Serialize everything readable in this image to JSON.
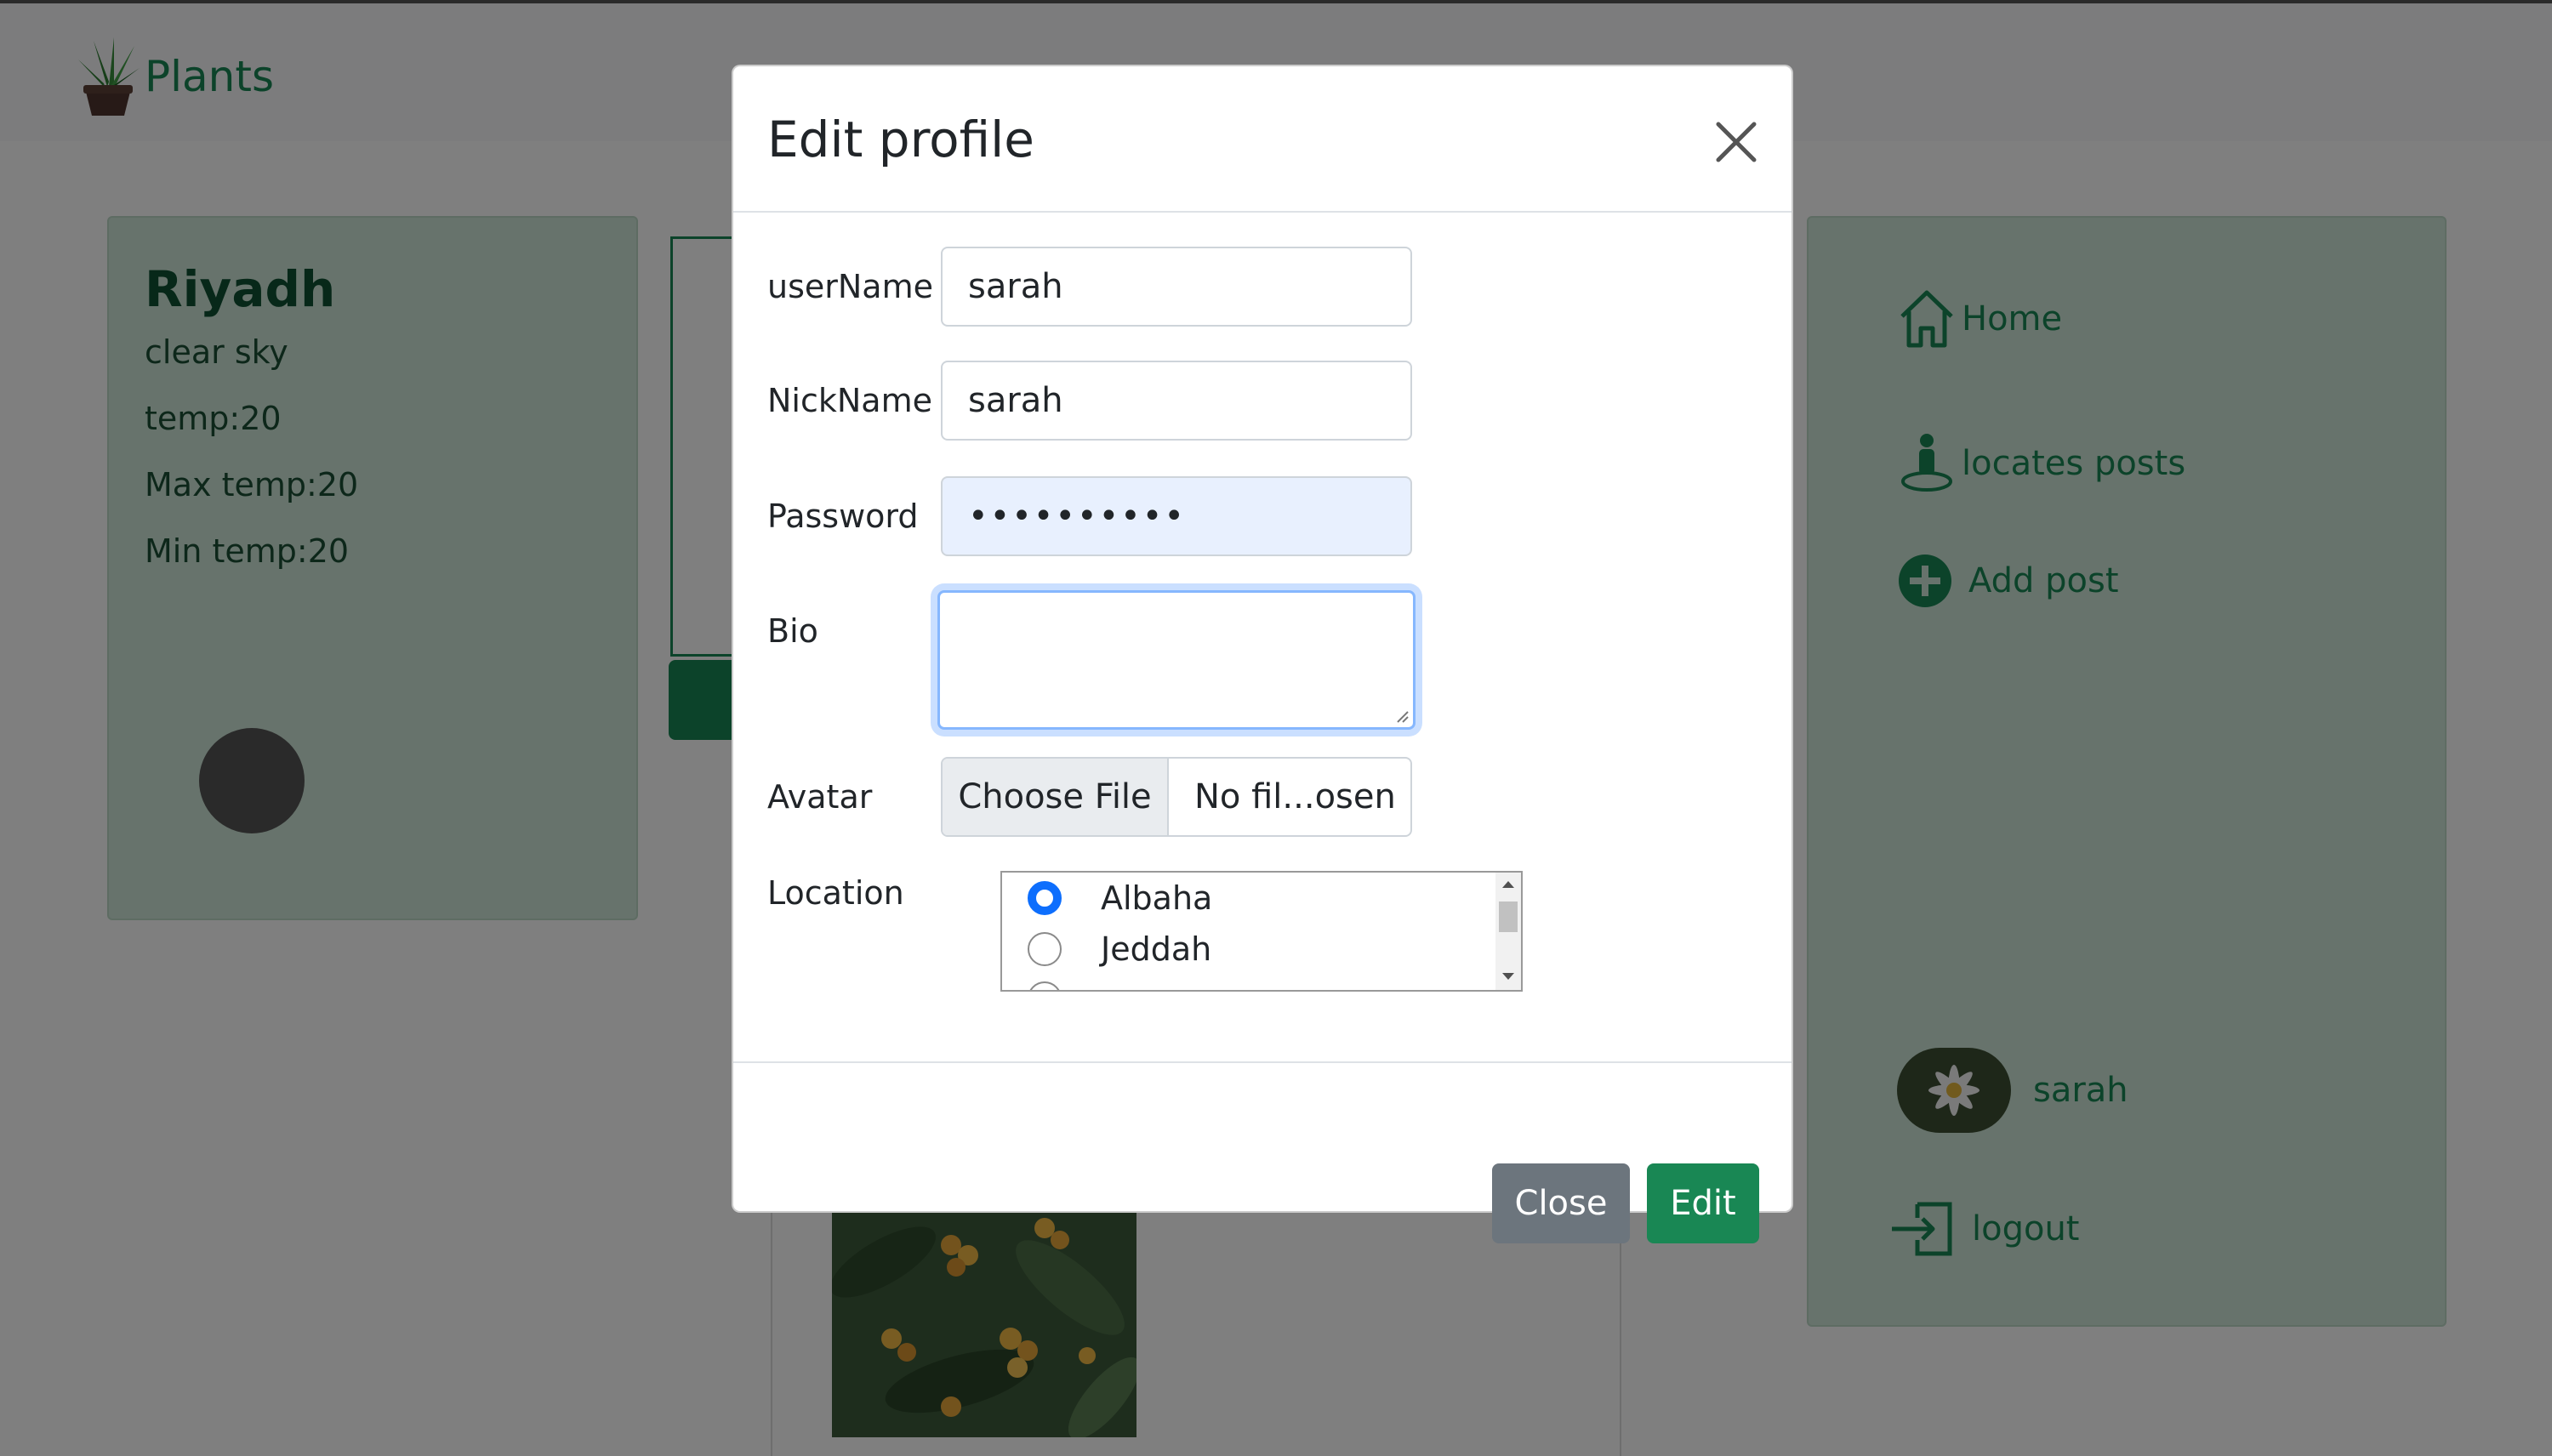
{
  "brand": {
    "name": "Plants"
  },
  "weather": {
    "city": "Riyadh",
    "description": "clear sky",
    "temp": "temp:20",
    "max_temp": "Max temp:20",
    "min_temp": "Min temp:20"
  },
  "nav": {
    "home": "Home",
    "locates_posts": "locates posts",
    "add_post": "Add post",
    "user": "sarah",
    "logout": "logout"
  },
  "modal": {
    "title": "Edit profile",
    "fields": {
      "username_label": "userName",
      "username_value": "sarah",
      "nickname_label": "NickName",
      "nickname_value": "sarah",
      "password_label": "Password",
      "password_value": "••••••••••",
      "bio_label": "Bio",
      "bio_value": "",
      "avatar_label": "Avatar",
      "avatar_button": "Choose File",
      "avatar_file": "No fil...osen",
      "location_label": "Location"
    },
    "locations": [
      {
        "name": "Albaha",
        "selected": true
      },
      {
        "name": "Jeddah",
        "selected": false
      }
    ],
    "close_label": "Close",
    "edit_label": "Edit"
  },
  "colors": {
    "brand_green": "#198754",
    "primary_blue": "#0d6efd",
    "secondary_gray": "#6c757d"
  }
}
